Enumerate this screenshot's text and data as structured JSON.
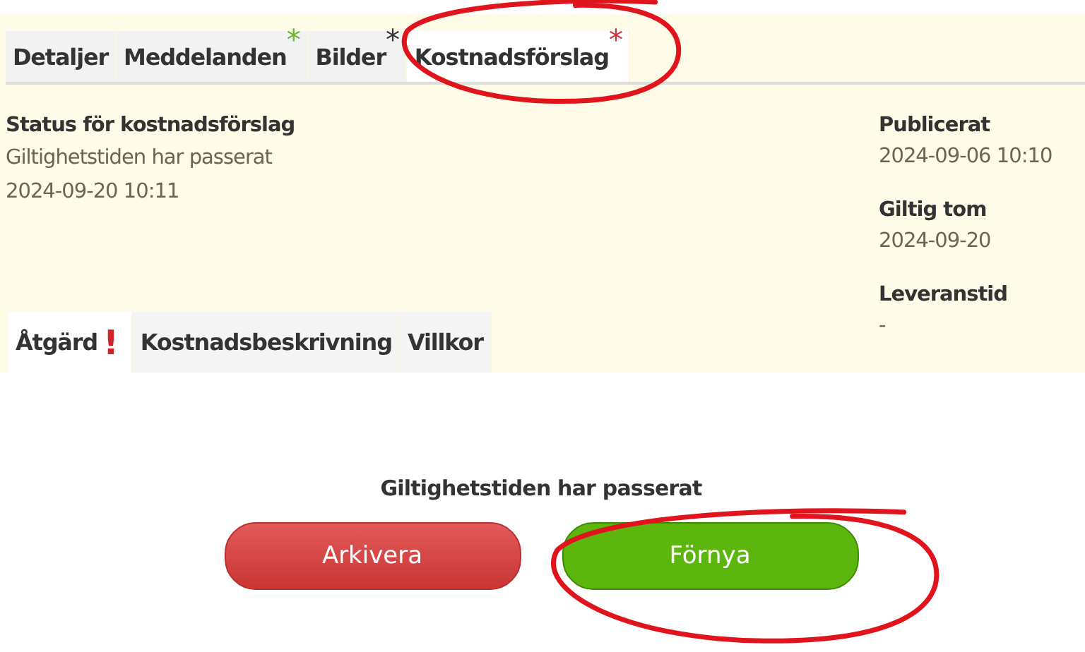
{
  "tabs": [
    {
      "label": "Detaljer",
      "selected": false,
      "circled": false
    },
    {
      "label": "Meddelanden",
      "selected": false,
      "circled": false,
      "mark": "*",
      "color": "#6cb52d"
    },
    {
      "label": "Bilder",
      "selected": false,
      "circled": false,
      "mark": "*",
      "color": "#333333"
    },
    {
      "label": "Kostnadsförslag",
      "selected": true,
      "circled": true,
      "mark": "*",
      "color": "#d0323a"
    }
  ],
  "status": {
    "heading": "Status för kostnadsförslag",
    "text": "Giltighetstiden har passerat",
    "date": "2024-09-20 10:11"
  },
  "details": [
    {
      "label": "Publicerat",
      "value": "2024-09-06 10:10"
    },
    {
      "label": "Giltig tom",
      "value": "2024-09-20"
    },
    {
      "label": "Leveranstid",
      "value": "-"
    }
  ],
  "subtabs": [
    {
      "label": "Åtgärd",
      "selected": true,
      "alert": "!"
    },
    {
      "label": "Kostnadsbeskrivning",
      "selected": false
    },
    {
      "label": "Villkor",
      "selected": false
    }
  ],
  "panel": {
    "message": "Giltighetstiden har passerat",
    "buttons": [
      {
        "label": "Arkivera",
        "kind": "danger",
        "circled": false
      },
      {
        "label": "Förnya",
        "kind": "success",
        "circled": true
      }
    ]
  }
}
